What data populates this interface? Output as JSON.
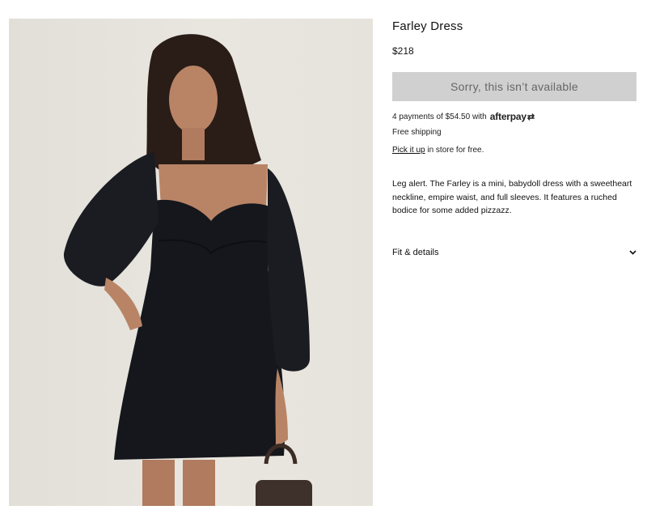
{
  "product": {
    "image_alt": "Model wearing a black puff-sleeve mini dress holding a brown handbag",
    "title": "Farley Dress",
    "price": "$218",
    "cta_label": "Sorry, this isn’t available",
    "afterpay": {
      "text": "4 payments of $54.50 with",
      "logo_text": "afterpay",
      "logo_mark": "⇄"
    },
    "shipping": "Free shipping",
    "pickup": {
      "link": "Pick it up",
      "rest": " in store for free."
    },
    "description": "Leg alert. The Farley is a mini, babydoll dress with a sweetheart neckline, empire waist, and full sleeves. It features a ruched bodice for some added pizzazz.",
    "details_label": "Fit & details",
    "details_icon": "chevron-down-icon"
  },
  "colors": {
    "cta_bg": "#d0d0d0",
    "cta_text": "#666666",
    "photo_bg": "#e6e3dc",
    "dress": "#15171c"
  }
}
